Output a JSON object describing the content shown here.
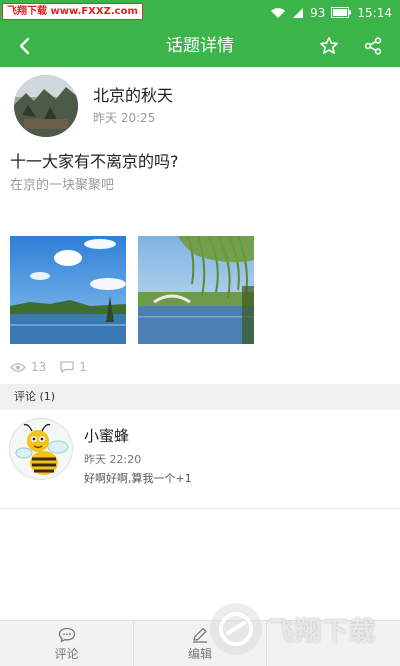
{
  "watermark": {
    "top_text": "飞翔下载 www.FXXZ.com",
    "bottom_text": "飞翔下载"
  },
  "status_bar": {
    "battery": "93",
    "time": "15:14",
    "icons": [
      "wifi-icon",
      "signal-icon",
      "battery-icon"
    ]
  },
  "app_bar": {
    "title": "话题详情",
    "icons": [
      "back-arrow-icon",
      "star-icon",
      "share-icon"
    ]
  },
  "post": {
    "author": "北京的秋天",
    "time": "昨天 20:25",
    "title": "十一大家有不离京的吗?",
    "body": "在京的一块聚聚吧",
    "photos": [
      "sky-and-lake-photo",
      "willow-bridge-photo"
    ],
    "views": "13",
    "comments": "1"
  },
  "comments_section": {
    "label": "评论 (1)",
    "items": [
      {
        "author": "小蜜蜂",
        "time": "昨天 22:20",
        "text": "好啊好啊,算我一个+1"
      }
    ]
  },
  "bottom_bar": {
    "comment_label": "评论",
    "edit_label": "编辑"
  },
  "colors": {
    "accent": "#3bb54a",
    "divider": "#f0f0f0"
  }
}
